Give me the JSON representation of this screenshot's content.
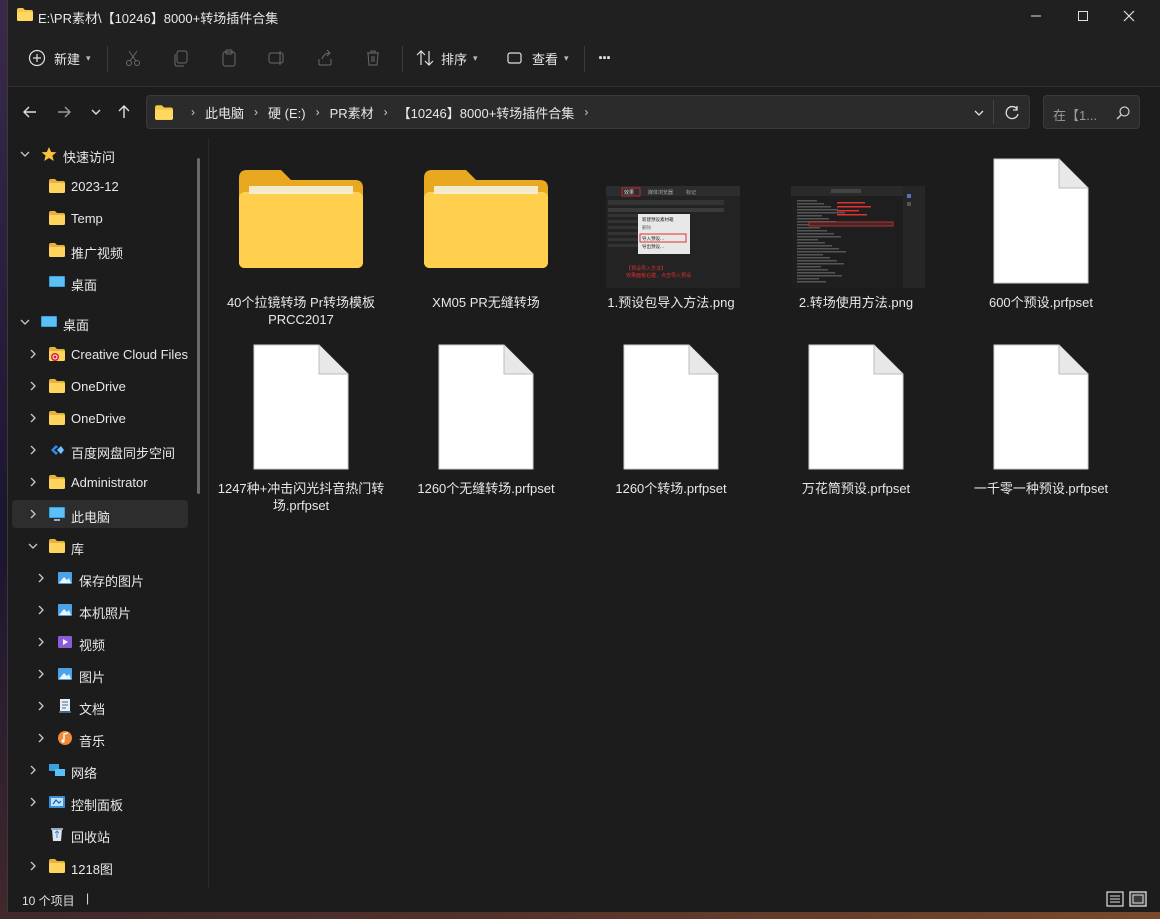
{
  "window": {
    "title": "E:\\PR素材\\【10246】8000+转场插件合集",
    "minimize": "—",
    "maximize": "☐",
    "close": "✕"
  },
  "toolbar": {
    "new_label": "新建",
    "sort_label": "排序",
    "view_label": "查看",
    "more_label": "···",
    "disabled_icons": [
      "cut-icon",
      "copy-icon",
      "paste-icon",
      "rename-icon",
      "share-icon",
      "delete-icon"
    ]
  },
  "address": {
    "crumbs": [
      "此电脑",
      "硬 (E:)",
      "PR素材",
      "【10246】8000+转场插件合集"
    ],
    "search_placeholder": "在【1..."
  },
  "sidebar": {
    "items": [
      {
        "label": "快速访问",
        "icon": "star-icon"
      },
      {
        "label": "2023-12",
        "icon": "folder-icon"
      },
      {
        "label": "Temp",
        "icon": "folder-icon"
      },
      {
        "label": "推广视频",
        "icon": "folder-icon"
      },
      {
        "label": "桌面",
        "icon": "desktop-icon"
      },
      {
        "label": "桌面",
        "icon": "desktop-icon"
      },
      {
        "label": "Creative Cloud Files",
        "icon": "creative-cloud-icon"
      },
      {
        "label": "OneDrive",
        "icon": "folder-icon"
      },
      {
        "label": "OneDrive",
        "icon": "folder-icon"
      },
      {
        "label": "百度网盘同步空间",
        "icon": "baidu-netdisk-icon"
      },
      {
        "label": "Administrator",
        "icon": "folder-icon"
      },
      {
        "label": "此电脑",
        "icon": "this-pc-icon"
      },
      {
        "label": "库",
        "icon": "library-icon"
      },
      {
        "label": "保存的图片",
        "icon": "pictures-icon"
      },
      {
        "label": "本机照片",
        "icon": "pictures-icon"
      },
      {
        "label": "视频",
        "icon": "videos-icon"
      },
      {
        "label": "图片",
        "icon": "pictures-icon"
      },
      {
        "label": "文档",
        "icon": "documents-icon"
      },
      {
        "label": "音乐",
        "icon": "music-icon"
      },
      {
        "label": "网络",
        "icon": "network-icon"
      },
      {
        "label": "控制面板",
        "icon": "control-panel-icon"
      },
      {
        "label": "回收站",
        "icon": "recycle-bin-icon"
      },
      {
        "label": "1218图",
        "icon": "folder-icon"
      }
    ]
  },
  "files": [
    {
      "name": "40个拉镜转场 Pr转场模板 PRCC2017",
      "type": "folder"
    },
    {
      "name": "XM05 PR无缝转场",
      "type": "folder"
    },
    {
      "name": "1.预设包导入方法.png",
      "type": "image"
    },
    {
      "name": "2.转场使用方法.png",
      "type": "image"
    },
    {
      "name": "600个预设.prfpset",
      "type": "file"
    },
    {
      "name": "1247种+冲击闪光抖音热门转场.prfpset",
      "type": "file"
    },
    {
      "name": "1260个无缝转场.prfpset",
      "type": "file"
    },
    {
      "name": "1260个转场.prfpset",
      "type": "file"
    },
    {
      "name": "万花筒预设.prfpset",
      "type": "file"
    },
    {
      "name": "一千零一种预设.prfpset",
      "type": "file"
    }
  ],
  "thumb1": {
    "tab1": "效果",
    "tab2": "媒体浏览器",
    "tab3": "标记",
    "menu1": "新建预设素材箱",
    "menu2": "删除",
    "menu3": "导入预设...",
    "menu4": "导出预设...",
    "note1": "【预设导入方法】",
    "note2": "效果面板右键，点击导入预设"
  },
  "status": {
    "count": "10 个项目",
    "cursor": "|"
  },
  "colors": {
    "accent": "#4cc2ff",
    "folder": "#f4c84a",
    "selected_bg": "#2d2d2d"
  }
}
